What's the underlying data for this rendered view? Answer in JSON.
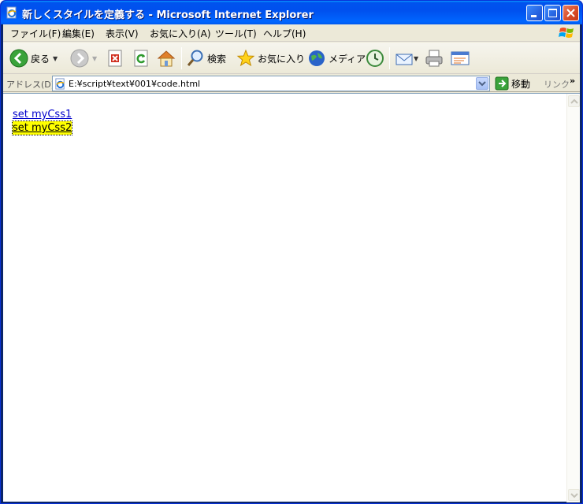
{
  "window": {
    "title": "新しくスタイルを定義する - Microsoft Internet Explorer"
  },
  "menu": {
    "items": [
      "ファイル(F)",
      "編集(E)",
      "表示(V)",
      "お気に入り(A)",
      "ツール(T)",
      "ヘルプ(H)"
    ]
  },
  "toolbar": {
    "back_label": "戻る",
    "search_label": "検索",
    "favorites_label": "お気に入り",
    "media_label": "メディア"
  },
  "address": {
    "label": "アドレス(D)",
    "value": "E:¥script¥text¥001¥code.html",
    "go_label": "移動",
    "links_label": "リンク",
    "more": "»"
  },
  "page": {
    "link1": "set myCss1",
    "link2": "set myCss2"
  },
  "colors": {
    "titlebar": "#0055e5",
    "link": "#0000cc",
    "highlight": "#ffff00"
  }
}
